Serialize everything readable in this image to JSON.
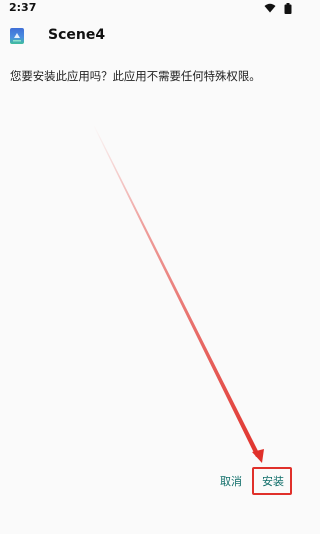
{
  "status_bar": {
    "time": "2:37",
    "icons": [
      "wifi-icon",
      "battery-icon"
    ]
  },
  "header": {
    "app_icon": "android-app-icon",
    "title": "Scene4"
  },
  "message": "您要安装此应用吗？此应用不需要任何特殊权限。",
  "actions": {
    "cancel_label": "取消",
    "install_label": "安装"
  },
  "colors": {
    "background": "#fafafa",
    "accent": "#0f6d69",
    "annotation": "#e0302a"
  }
}
